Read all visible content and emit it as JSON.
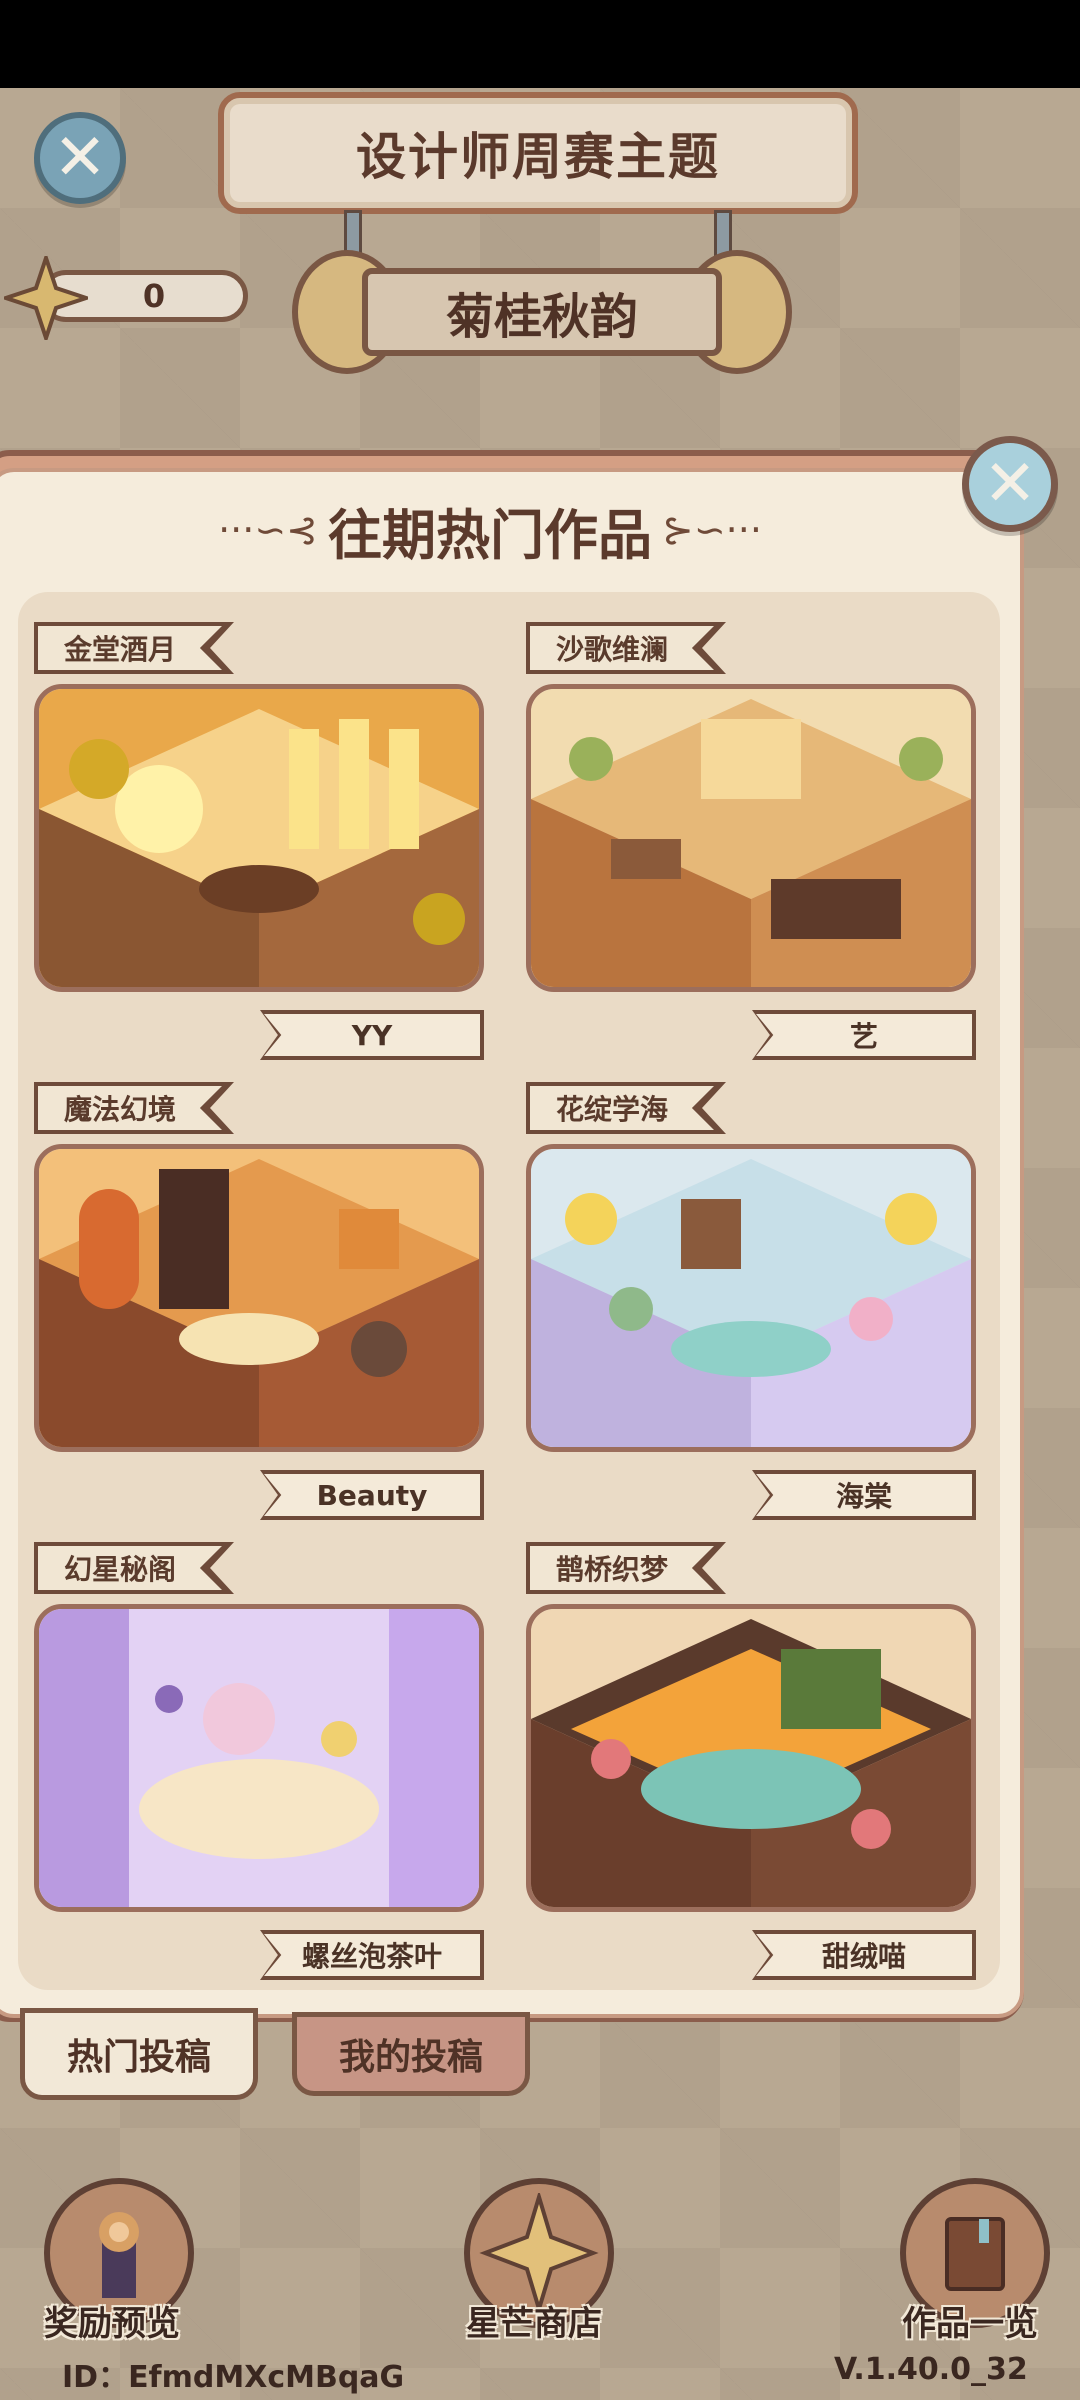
{
  "header": {
    "title": "设计师周赛主题",
    "theme": "菊桂秋韵",
    "star_count": "0"
  },
  "panel": {
    "heading": "往期热门作品",
    "works": [
      {
        "name": "金堂酒月",
        "author": "YY",
        "palette": [
          "#f4c24a",
          "#d98a2b",
          "#7b4a2c"
        ]
      },
      {
        "name": "沙歌维澜",
        "author": "艺",
        "palette": [
          "#e8c27a",
          "#b9743e",
          "#5e3a2a"
        ]
      },
      {
        "name": "魔法幻境",
        "author": "Beauty",
        "palette": [
          "#f0b45a",
          "#a65a35",
          "#4a2d24"
        ]
      },
      {
        "name": "花绽学海",
        "author": "海棠",
        "palette": [
          "#bfe0e8",
          "#d9c6f0",
          "#8fb98a"
        ]
      },
      {
        "name": "幻星秘阁",
        "author": "螺丝泡茶叶",
        "palette": [
          "#c9b2ec",
          "#f1c8dc",
          "#8a6ab8"
        ]
      },
      {
        "name": "鹊桥织梦",
        "author": "甜绒喵",
        "palette": [
          "#7cc4b6",
          "#f3a33a",
          "#6a3e2c"
        ]
      }
    ]
  },
  "tabs": {
    "hot": "热门投稿",
    "mine": "我的投稿"
  },
  "nav": {
    "rewards": "奖励预览",
    "shop": "星芒商店",
    "works": "作品一览"
  },
  "footer": {
    "id": "ID：EfmdMXcMBqaG",
    "version": "V.1.40.0_32"
  }
}
